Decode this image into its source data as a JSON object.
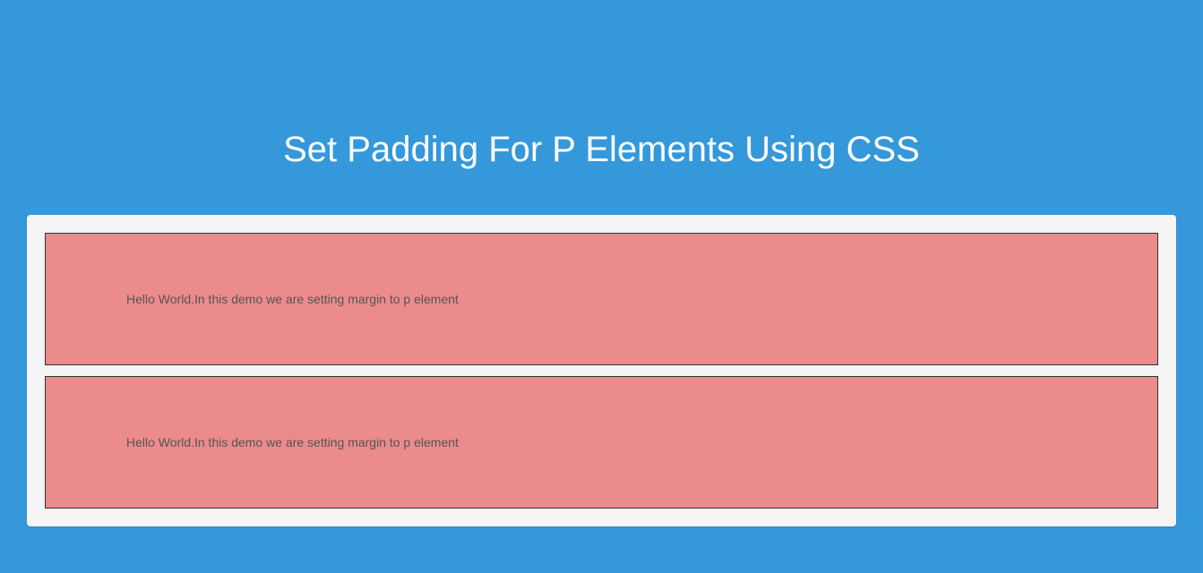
{
  "title": "Set Padding For P Elements Using CSS",
  "paragraphs": [
    "Hello World.In this demo we are setting margin to p element",
    "Hello World.In this demo we are setting margin to p element"
  ]
}
